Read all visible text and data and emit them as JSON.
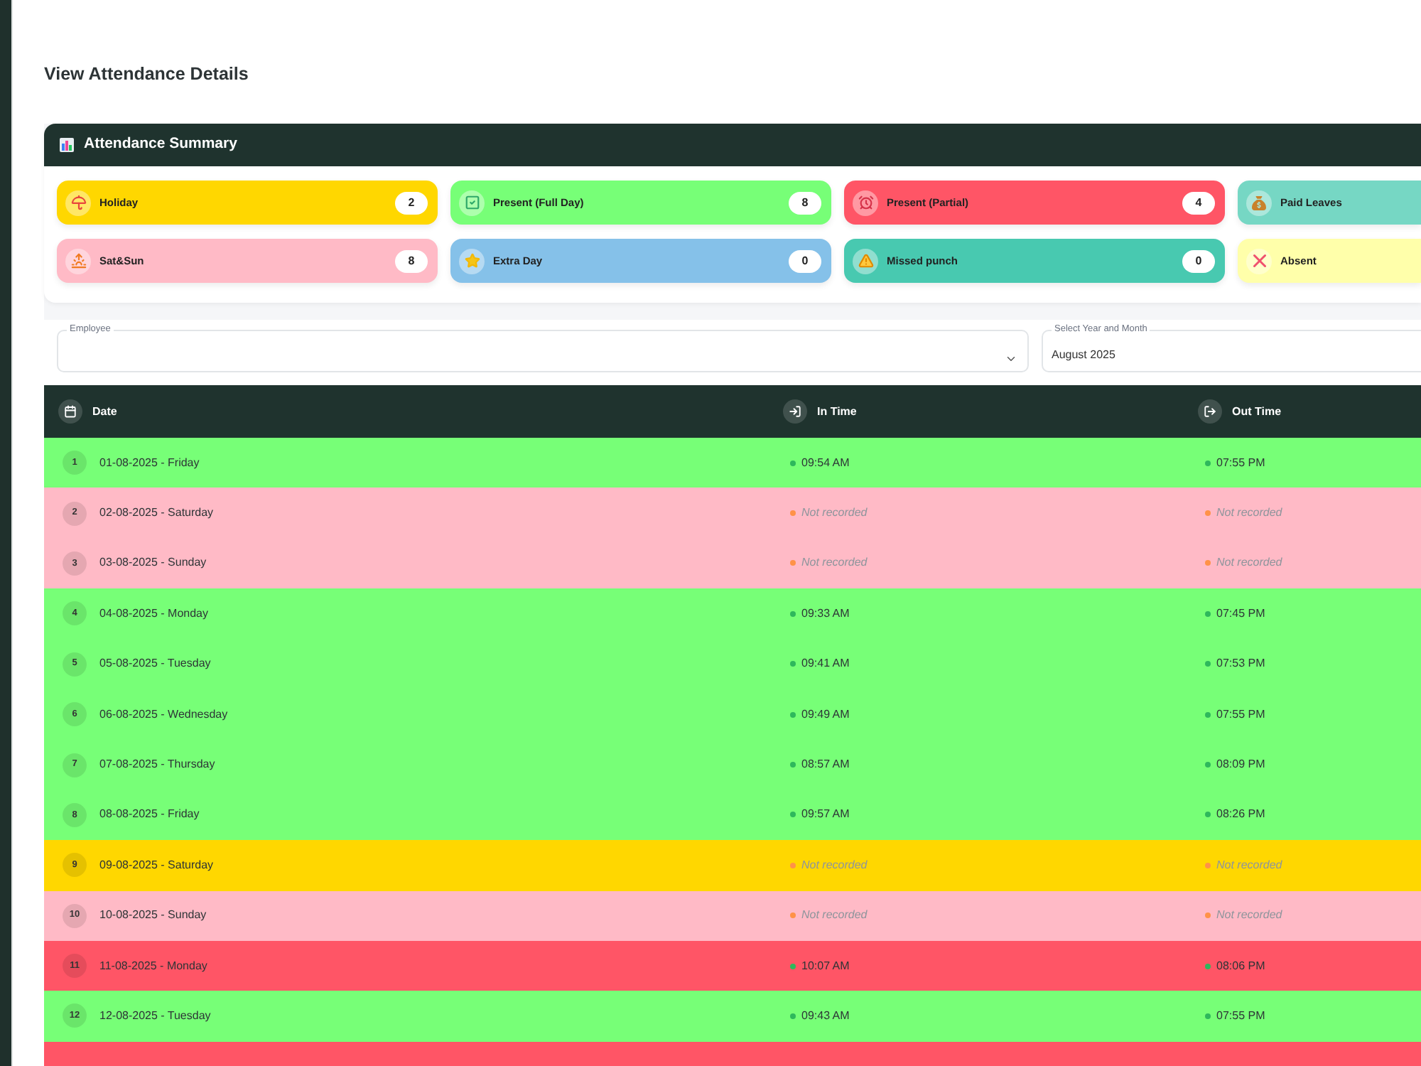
{
  "page": {
    "title": "View Attendance Details"
  },
  "summary": {
    "title": "Attendance Summary",
    "items": [
      {
        "kind": "holiday",
        "label": "Holiday",
        "count": "2",
        "color": "#ffd700"
      },
      {
        "kind": "present_full",
        "label": "Present (Full Day)",
        "count": "8",
        "color": "#77ff77"
      },
      {
        "kind": "present_partial",
        "label": "Present (Partial)",
        "count": "4",
        "color": "#ff5566"
      },
      {
        "kind": "paid_leave",
        "label": "Paid Leaves",
        "color": "#76d7c4"
      },
      {
        "kind": "weekend",
        "label": "Sat&Sun",
        "count": "8",
        "color": "#ffbac6"
      },
      {
        "kind": "extra_day",
        "label": "Extra Day",
        "count": "0",
        "color": "#85c1e9"
      },
      {
        "kind": "missed_punch",
        "label": "Missed punch",
        "count": "0",
        "color": "#48c9b0"
      },
      {
        "kind": "absent",
        "label": "Absent",
        "color": "#ffffaa"
      }
    ]
  },
  "filters": {
    "employee": {
      "label": "Employee"
    },
    "month": {
      "label": "Select Year and Month",
      "value": "August 2025"
    }
  },
  "table": {
    "columns": [
      {
        "kind": "date",
        "label": "Date"
      },
      {
        "kind": "in",
        "label": "In Time"
      },
      {
        "kind": "out",
        "label": "Out Time"
      }
    ],
    "rows": [
      {
        "number": "1",
        "date": "01-08-2025 - Friday",
        "color": "#77ff77",
        "in_time": {
          "text": "09:54 AM",
          "recorded": true
        },
        "out_time": {
          "text": "07:55 PM",
          "recorded": true
        }
      },
      {
        "number": "2",
        "date": "02-08-2025 - Saturday",
        "color": "#ffbac6",
        "in_time": {
          "text": "Not recorded",
          "recorded": false
        },
        "out_time": {
          "text": "Not recorded",
          "recorded": false
        }
      },
      {
        "number": "3",
        "date": "03-08-2025 - Sunday",
        "color": "#ffbac6",
        "in_time": {
          "text": "Not recorded",
          "recorded": false
        },
        "out_time": {
          "text": "Not recorded",
          "recorded": false
        }
      },
      {
        "number": "4",
        "date": "04-08-2025 - Monday",
        "color": "#77ff77",
        "in_time": {
          "text": "09:33 AM",
          "recorded": true
        },
        "out_time": {
          "text": "07:45 PM",
          "recorded": true
        }
      },
      {
        "number": "5",
        "date": "05-08-2025 - Tuesday",
        "color": "#77ff77",
        "in_time": {
          "text": "09:41 AM",
          "recorded": true
        },
        "out_time": {
          "text": "07:53 PM",
          "recorded": true
        }
      },
      {
        "number": "6",
        "date": "06-08-2025 - Wednesday",
        "color": "#77ff77",
        "in_time": {
          "text": "09:49 AM",
          "recorded": true
        },
        "out_time": {
          "text": "07:55 PM",
          "recorded": true
        }
      },
      {
        "number": "7",
        "date": "07-08-2025 - Thursday",
        "color": "#77ff77",
        "in_time": {
          "text": "08:57 AM",
          "recorded": true
        },
        "out_time": {
          "text": "08:09 PM",
          "recorded": true
        }
      },
      {
        "number": "8",
        "date": "08-08-2025 - Friday",
        "color": "#77ff77",
        "in_time": {
          "text": "09:57 AM",
          "recorded": true
        },
        "out_time": {
          "text": "08:26 PM",
          "recorded": true
        }
      },
      {
        "number": "9",
        "date": "09-08-2025 - Saturday",
        "color": "#ffd700",
        "in_time": {
          "text": "Not recorded",
          "recorded": false
        },
        "out_time": {
          "text": "Not recorded",
          "recorded": false
        }
      },
      {
        "number": "10",
        "date": "10-08-2025 - Sunday",
        "color": "#ffbac6",
        "in_time": {
          "text": "Not recorded",
          "recorded": false
        },
        "out_time": {
          "text": "Not recorded",
          "recorded": false
        }
      },
      {
        "number": "11",
        "date": "11-08-2025 - Monday",
        "color": "#ff5566",
        "in_time": {
          "text": "10:07 AM",
          "recorded": true
        },
        "out_time": {
          "text": "08:06 PM",
          "recorded": true
        }
      },
      {
        "number": "12",
        "date": "12-08-2025 - Tuesday",
        "color": "#77ff77",
        "in_time": {
          "text": "09:43 AM",
          "recorded": true
        },
        "out_time": {
          "text": "07:55 PM",
          "recorded": true
        }
      },
      {
        "color": "#ff5566"
      }
    ]
  }
}
